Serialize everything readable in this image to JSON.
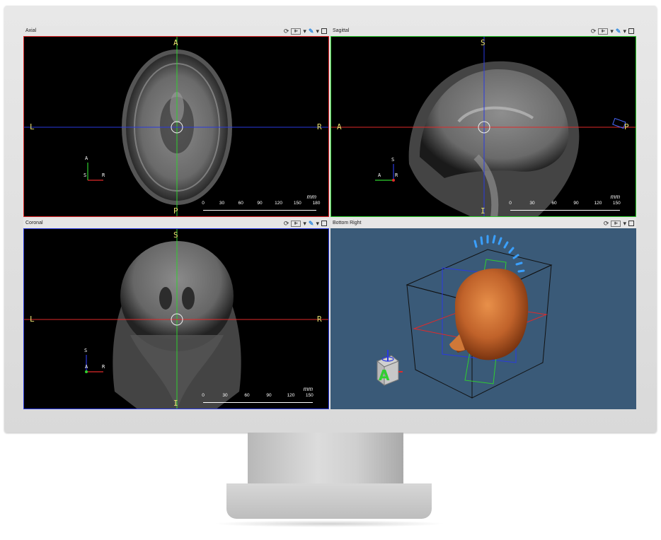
{
  "views": {
    "axial": {
      "title": "Axial",
      "border_color": "#e02a2a",
      "orient": {
        "top": "A",
        "bottom": "P",
        "left": "L",
        "right": "R"
      },
      "triad": {
        "up": "A",
        "center": "S",
        "right": "R"
      },
      "scale": {
        "unit": "mm",
        "labels": [
          "0",
          "30",
          "60",
          "90",
          "120",
          "150",
          "180"
        ]
      }
    },
    "sagittal": {
      "title": "Sagittal",
      "border_color": "#2fcf2f",
      "orient": {
        "top": "S",
        "bottom": "I",
        "left": "A",
        "right": "P"
      },
      "triad": {
        "up": "S",
        "left": "A",
        "center": "R"
      },
      "scale": {
        "unit": "mm",
        "labels": [
          "0",
          "30",
          "60",
          "90",
          "120",
          "150"
        ]
      }
    },
    "coronal": {
      "title": "Coronal",
      "border_color": "#2a3ae0",
      "orient": {
        "top": "S",
        "bottom": "I",
        "left": "L",
        "right": "R"
      },
      "triad": {
        "up": "S",
        "center": "A",
        "right": "R"
      },
      "scale": {
        "unit": "mm",
        "labels": [
          "0",
          "30",
          "60",
          "90",
          "120",
          "150"
        ]
      }
    },
    "three_d": {
      "title": "Bottom Right",
      "background": "#3a5a78",
      "cube_label": "A"
    }
  },
  "toolbar_icons": [
    "reset-icon",
    "layout-icon",
    "dropdown-icon",
    "pencil-icon",
    "dropdown-icon",
    "maximize-icon"
  ],
  "crosshair_colors": {
    "red": "#e02a2a",
    "green": "#2fcf2f",
    "blue": "#2a3ae0"
  }
}
